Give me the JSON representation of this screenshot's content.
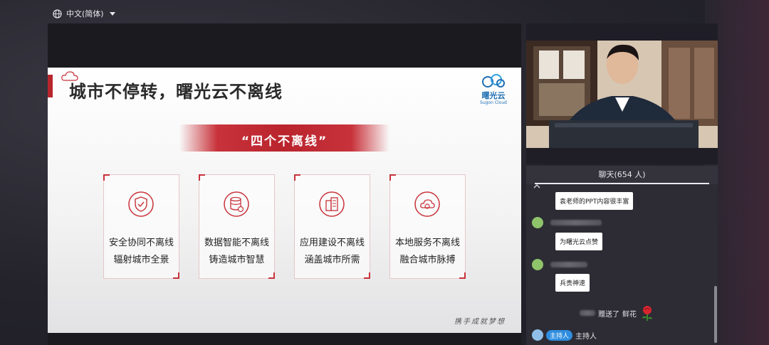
{
  "topbar": {
    "language": "中文(简体)",
    "icons": {
      "globe": "globe-icon",
      "dropdown": "caret-down-icon"
    }
  },
  "slide": {
    "title": "城市不停转，曙光云不离线",
    "logo_zh": "曙光云",
    "logo_en": "Sugon Cloud",
    "banner": "“四个不离线”",
    "cards": [
      {
        "icon": "shield-check-icon",
        "line1": "安全协同不离线",
        "line2": "辐射城市全景"
      },
      {
        "icon": "database-icon",
        "line1": "数据智能不离线",
        "line2": "铸造城市智慧"
      },
      {
        "icon": "buildings-icon",
        "line1": "应用建设不离线",
        "line2": "涵盖城市所需"
      },
      {
        "icon": "cloud-service-icon",
        "line1": "本地服务不离线",
        "line2": "融合城市脉搏"
      }
    ],
    "signature": "携手成就梦想"
  },
  "chat": {
    "header": "聊天(654 人)",
    "messages": [
      {
        "text": "袁老师的PPT内容很丰富"
      },
      {
        "text": "为曙光云点赞"
      },
      {
        "text": "兵贵神速"
      }
    ],
    "gift": {
      "verb": "赠送了",
      "item": "鲜花",
      "icon": "rose-icon"
    },
    "host": {
      "badge": "主持人",
      "name": "主持人"
    }
  },
  "colors": {
    "accent": "#c8333b",
    "host_badge": "#2f8ee0",
    "avatar_green": "#8fc46a",
    "avatar_blue": "#8fbfe8"
  }
}
